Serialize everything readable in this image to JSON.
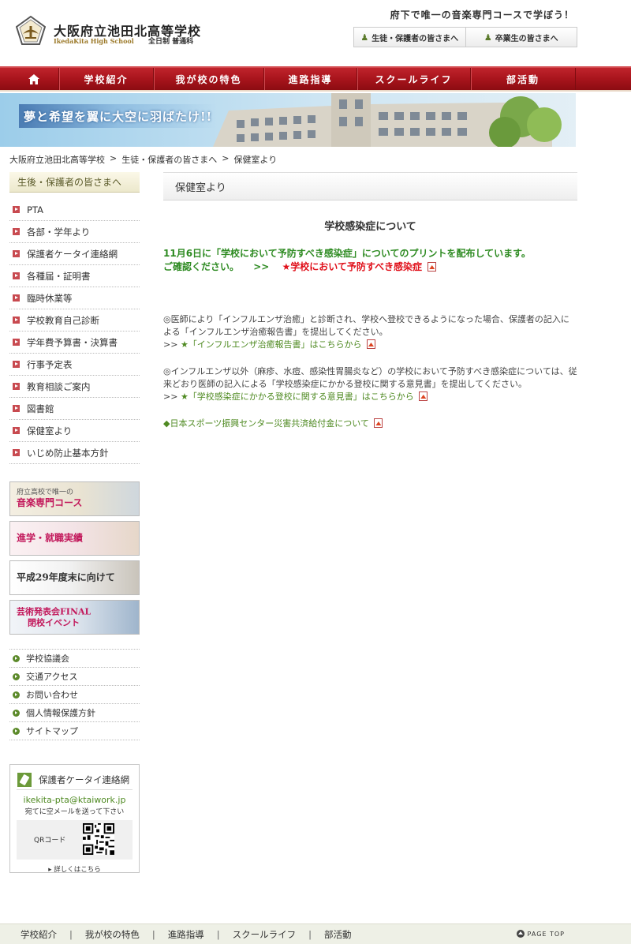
{
  "header": {
    "school_name": "大阪府立池田北高等学校",
    "school_name_en": "IkedaKita High School",
    "course_label": "全日制 普通科",
    "tagline": "府下で唯一の音楽専門コースで学ぼう！",
    "buttons": [
      {
        "label": "生徒・保護者の皆さまへ"
      },
      {
        "label": "卒業生の皆さまへ"
      }
    ]
  },
  "nav": {
    "home_icon": "home-icon",
    "items": [
      {
        "label": "学校紹介"
      },
      {
        "label": "我が校の特色"
      },
      {
        "label": "進路指導"
      },
      {
        "label": "スクールライフ"
      },
      {
        "label": "部活動"
      }
    ]
  },
  "banner": {
    "text": "夢と希望を翼に大空に羽ばたけ!!"
  },
  "breadcrumb": {
    "items": [
      "大阪府立池田北高等学校",
      "生徒・保護者の皆さまへ",
      "保健室より"
    ],
    "separator": ">"
  },
  "sidebar": {
    "heading": "生後・保護者の皆さまへ",
    "links": [
      "PTA",
      "各部・学年より",
      "保護者ケータイ連絡網",
      "各種届・証明書",
      "臨時休業等",
      "学校教育自己診断",
      "学年費予算書・決算書",
      "行事予定表",
      "教育相談ご案内",
      "図書館",
      "保健室より",
      "いじめ防止基本方針"
    ],
    "banners": [
      {
        "line1": "府立高校で唯一の",
        "line2": "音楽専門コース"
      },
      {
        "line1": "進学・就職実績"
      },
      {
        "line1": "平成29年度末に向けて"
      },
      {
        "line1": "芸術発表会FINAL",
        "line2": "閉校イベント"
      }
    ],
    "sub_links": [
      "学校協議会",
      "交通アクセス",
      "お問い合わせ",
      "個人情報保護方針",
      "サイトマップ"
    ],
    "mobile_box": {
      "title": "保護者ケータイ連絡網",
      "email": "ikekita-pta@ktaiwork.jp",
      "note": "宛てに空メールを送って下さい",
      "qr_label": "QRコード",
      "more_label": "詳しくはこちら"
    }
  },
  "main": {
    "page_title": "保健室より",
    "section_heading": "学校感染症について",
    "notice_line1": "11月6日に「学校において予防すべき感染症」についてのプリントを配布しています。",
    "notice_line2": "ご確認ください。",
    "notice_arrow": ">>",
    "notice_link": "★学校において予防すべき感染症",
    "para1_text": "◎医師により「インフルエンザ治癒」と診断され、学校へ登校できるようになった場合、保護者の記入による「インフルエンザ治癒報告書」を提出してください。",
    "para1_arrow": ">>",
    "para1_link": "★「インフルエンザ治癒報告書」はこちらから",
    "para2_text": "◎インフルエンザ以外（麻疹、水痘、感染性胃腸炎など）の学校において予防すべき感染症については、従来どおり医師の記入による「学校感染症にかかる登校に関する意見書」を提出してください。",
    "para2_arrow": ">>",
    "para2_link": "★「学校感染症にかかる登校に関する意見書」はこちらから",
    "para3_link": "◆日本スポーツ振興センター災害共済給付金について"
  },
  "footer": {
    "links": [
      "学校紹介",
      "我が校の特色",
      "進路指導",
      "スクールライフ",
      "部活動"
    ],
    "separator": "|",
    "page_top": "PAGE TOP"
  },
  "colors": {
    "nav_red": "#a8141c",
    "notice_green": "#2e8b22",
    "notice_red": "#e0101a",
    "link_green": "#4f8a22"
  }
}
